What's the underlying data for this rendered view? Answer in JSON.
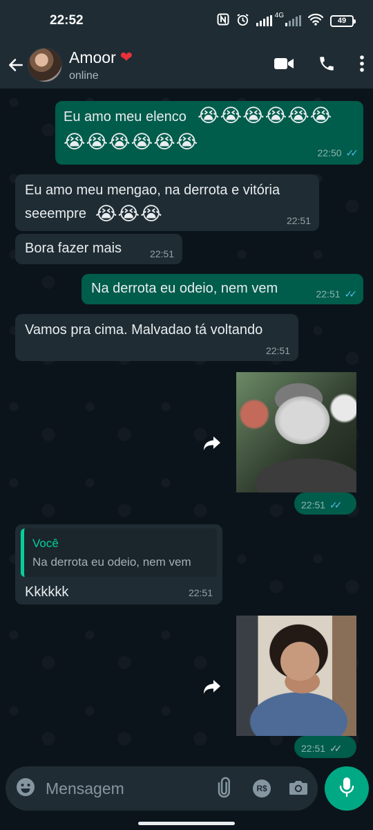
{
  "status_bar": {
    "time": "22:52",
    "network": "4G",
    "battery": "49"
  },
  "header": {
    "contact_name": "Amoor",
    "name_emoji": "❤",
    "status": "online",
    "icons": [
      "back-arrow-icon",
      "video-call-icon",
      "phone-icon",
      "more-options-icon"
    ]
  },
  "messages": [
    {
      "direction": "out",
      "text": "Eu amo meu elenco",
      "emoji": "😭😭😭😭😭😭😭😭😭😭😭😭",
      "time": "22:50",
      "read": true
    },
    {
      "direction": "in",
      "text": "Eu amo meu mengao, na derrota e vitória seeempre",
      "emoji": "😭😭😭",
      "time": "22:51"
    },
    {
      "direction": "in",
      "text": "Bora fazer mais",
      "time": "22:51"
    },
    {
      "direction": "out",
      "text": "Na derrota eu odeio, nem vem",
      "time": "22:51",
      "read": true
    },
    {
      "direction": "in",
      "text": "Vamos pra cima. Malvadao tá voltando",
      "time": "22:51"
    },
    {
      "direction": "out",
      "type": "sticker",
      "description": "sad-boy-photo",
      "time": "22:51",
      "read": true
    },
    {
      "direction": "in",
      "reply_to": {
        "author": "Você",
        "text": "Na derrota eu odeio, nem vem"
      },
      "text": "Kkkkkk",
      "time": "22:51"
    },
    {
      "direction": "out",
      "type": "sticker",
      "description": "laughing-woman-photo",
      "time": "22:51",
      "read": false
    }
  ],
  "input": {
    "placeholder": "Mensagem",
    "payment_label": "R$",
    "icons": [
      "emoji-icon",
      "attach-icon",
      "payment-icon",
      "camera-icon",
      "mic-icon"
    ]
  },
  "colors": {
    "background": "#0b141a",
    "header": "#1f2c34",
    "outgoing_bubble": "#005c4b",
    "incoming_bubble": "#1f2c34",
    "accent": "#00a884",
    "read_ticks": "#53bdeb"
  }
}
